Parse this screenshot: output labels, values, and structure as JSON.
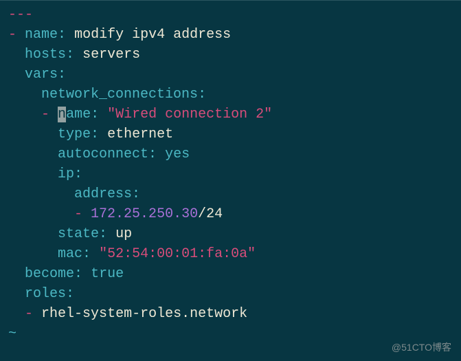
{
  "yaml": {
    "doc_start": "---",
    "dash": "-",
    "name_key": "name",
    "name_val": "modify ipv4 address",
    "hosts_key": "hosts",
    "hosts_val": "servers",
    "vars_key": "vars",
    "nc_key": "network_connections",
    "conn_name_key_cursor": "n",
    "conn_name_key_rest": "ame",
    "conn_name_val": "\"Wired connection 2\"",
    "type_key": "type",
    "type_val": "ethernet",
    "autoconnect_key": "autoconnect",
    "autoconnect_val": "yes",
    "ip_key": "ip",
    "address_key": "address",
    "address_val_ip": "172.25.250.30",
    "address_val_mask": "/24",
    "state_key": "state",
    "state_val": "up",
    "mac_key": "mac",
    "mac_val": "\"52:54:00:01:fa:0a\"",
    "become_key": "become",
    "become_val": "true",
    "roles_key": "roles",
    "role_item": "rhel-system-roles.network",
    "tilde": "~",
    "colon": ":",
    "space": " "
  },
  "watermark": "@51CTO博客"
}
